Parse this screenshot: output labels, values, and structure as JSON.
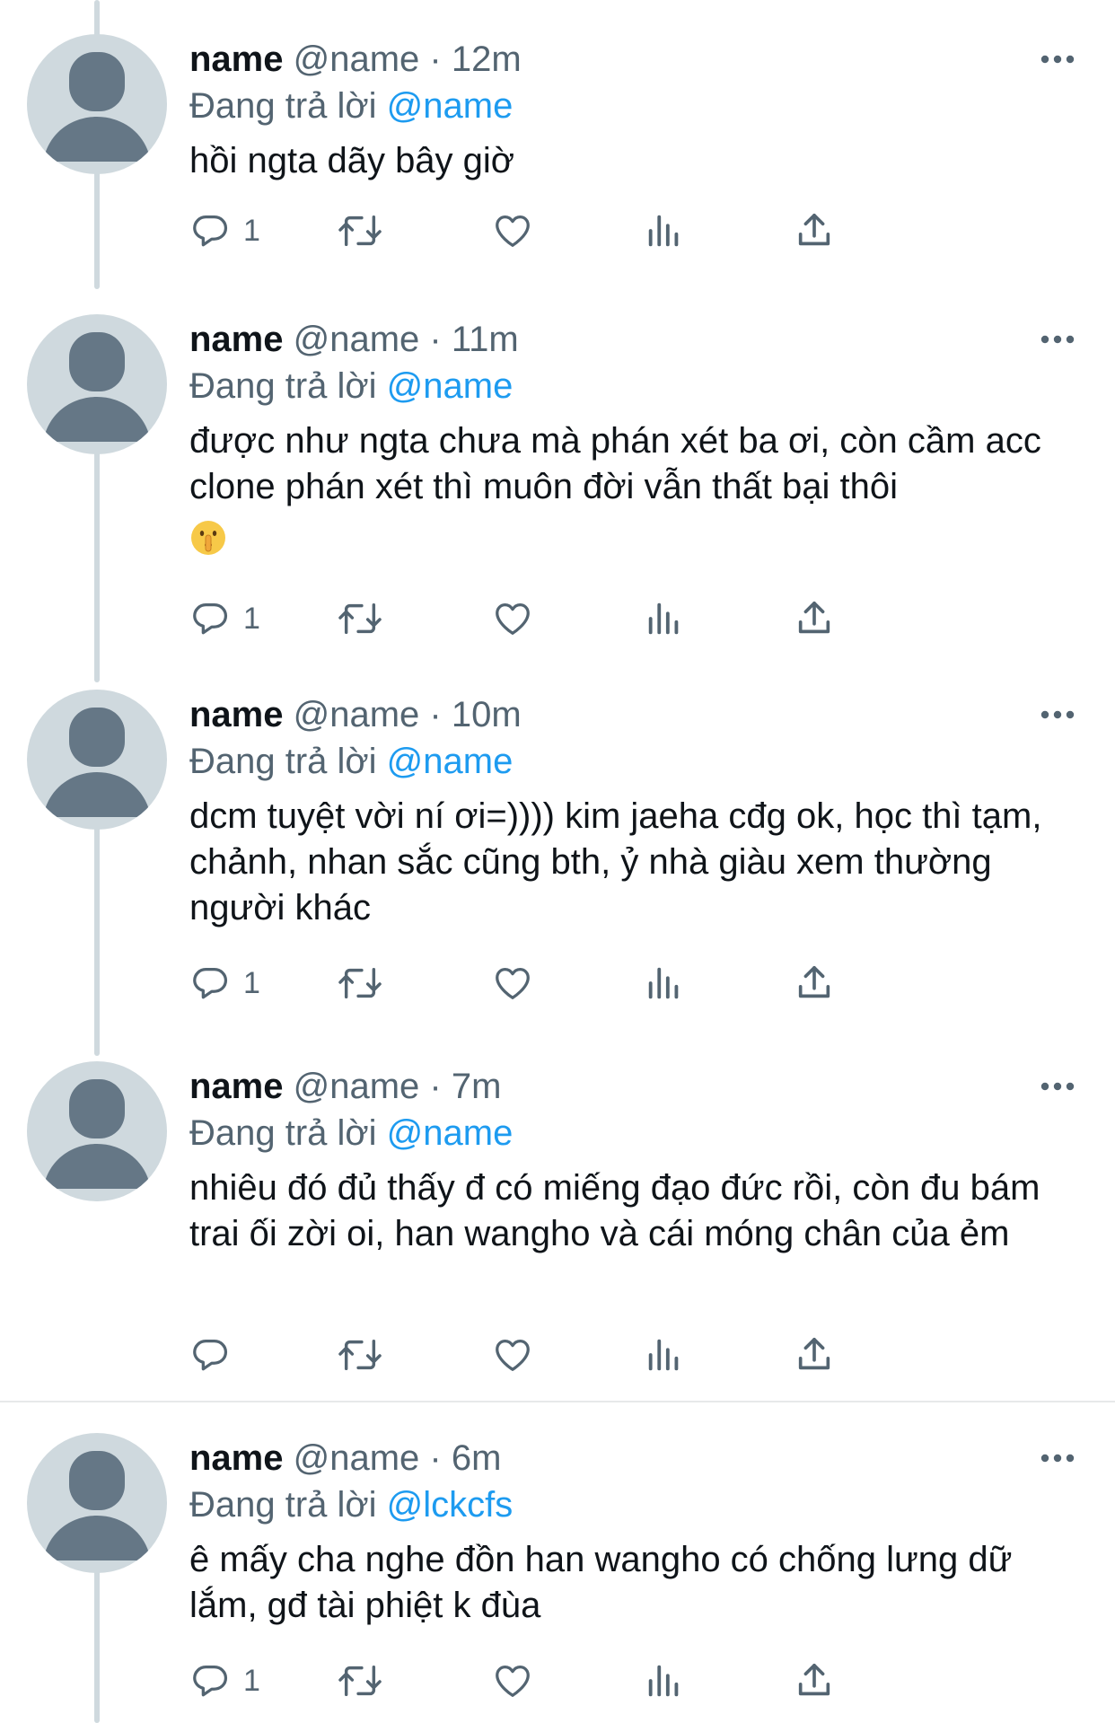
{
  "tweets": [
    {
      "name": "name",
      "handle": "@name",
      "separator": "·",
      "time": "12m",
      "replying_label": "Đang trả lời",
      "replying_to": "@name",
      "text": "hồi ngta dãy bây giờ",
      "reply_count": "1"
    },
    {
      "name": "name",
      "handle": "@name",
      "separator": "·",
      "time": "11m",
      "replying_label": "Đang trả lời",
      "replying_to": "@name",
      "text": "được như ngta chưa mà phán xét ba ơi, còn cầm acc clone phán xét thì muôn đời vẫn thất bại thôi",
      "emoji": "shushing-face-emoji",
      "reply_count": "1"
    },
    {
      "name": "name",
      "handle": "@name",
      "separator": "·",
      "time": "10m",
      "replying_label": "Đang trả lời",
      "replying_to": "@name",
      "text": "dcm tuyệt vời ní ơi=)))) kim jaeha cđg ok, học thì tạm, chảnh, nhan sắc cũng bth, ỷ nhà giàu xem thường người khác",
      "reply_count": "1"
    },
    {
      "name": "name",
      "handle": "@name",
      "separator": "·",
      "time": "7m",
      "replying_label": "Đang trả lời",
      "replying_to": "@name",
      "text": "nhiêu đó đủ thấy đ có miếng đạo đức rồi, còn đu bám trai ối zời oi, han wangho và cái móng chân của ẻm",
      "reply_count": ""
    },
    {
      "name": "name",
      "handle": "@name",
      "separator": "·",
      "time": "6m",
      "replying_label": "Đang trả lời",
      "replying_to": "@lckcfs",
      "text": "ê mấy cha nghe đồn han wangho có chống lưng dữ lắm, gđ tài phiệt k đùa",
      "reply_count": "1"
    }
  ],
  "icons": {
    "reply": "reply-icon",
    "retweet": "retweet-icon",
    "like": "heart-icon",
    "views": "views-icon",
    "share": "share-icon",
    "more": "more-options-icon",
    "avatar": "default-avatar-icon"
  },
  "colors": {
    "text": "#0f1419",
    "secondary": "#536471",
    "mention": "#1d9bf0",
    "avatar_bg": "#cfd9de",
    "avatar_fg": "#657786",
    "thread_line": "#cfd9de"
  }
}
